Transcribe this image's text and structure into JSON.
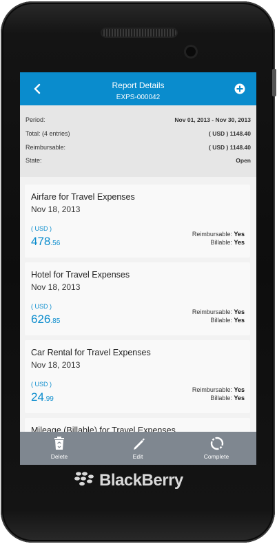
{
  "header": {
    "title": "Report Details",
    "subtitle": "EXPS-000042"
  },
  "summary": {
    "period_label": "Period:",
    "period_value": "Nov 01, 2013 - Nov 30, 2013",
    "total_label": "Total: (4 entries)",
    "total_value": "( USD ) 1148.40",
    "reimbursable_label": "Reimbursable:",
    "reimbursable_value": "( USD ) 1148.40",
    "state_label": "State:",
    "state_value": "Open"
  },
  "expenses": [
    {
      "title": "Airfare for Travel Expenses",
      "date": "Nov 18, 2013",
      "currency": "( USD )",
      "amount_whole": "478",
      "amount_cents": ".56",
      "reimbursable_label": "Reimbursable:",
      "reimbursable_value": "Yes",
      "billable_label": "Billable:",
      "billable_value": "Yes"
    },
    {
      "title": "Hotel for Travel Expenses",
      "date": "Nov 18, 2013",
      "currency": "( USD )",
      "amount_whole": "626",
      "amount_cents": ".85",
      "reimbursable_label": "Reimbursable:",
      "reimbursable_value": "Yes",
      "billable_label": "Billable:",
      "billable_value": "Yes"
    },
    {
      "title": "Car Rental for Travel Expenses",
      "date": "Nov 18, 2013",
      "currency": "( USD )",
      "amount_whole": "24",
      "amount_cents": ".99",
      "reimbursable_label": "Reimbursable:",
      "reimbursable_value": "Yes",
      "billable_label": "Billable:",
      "billable_value": "Yes"
    },
    {
      "title": "Mileage (Billable) for Travel Expenses"
    }
  ],
  "toolbar": {
    "delete_label": "Delete",
    "edit_label": "Edit",
    "complete_label": "Complete"
  },
  "device": {
    "brand": "BlackBerry"
  },
  "colors": {
    "accent": "#0a8ccd",
    "toolbar": "#7f8790",
    "summary_bg": "#e6e6e6"
  },
  "icons": [
    "back-icon",
    "add-icon",
    "delete-icon",
    "edit-icon",
    "complete-icon",
    "blackberry-logo-icon"
  ]
}
